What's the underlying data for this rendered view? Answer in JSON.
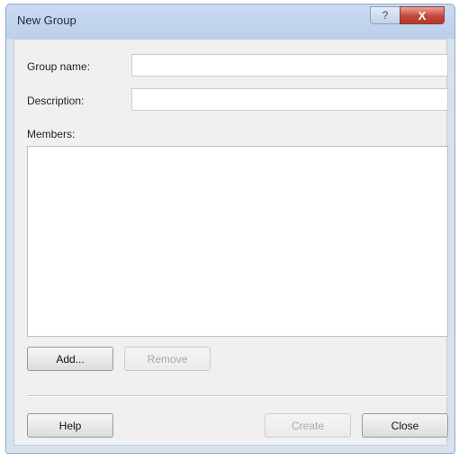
{
  "window": {
    "title": "New Group",
    "help_label": "?",
    "close_label": "X"
  },
  "form": {
    "group_name_label": "Group name:",
    "group_name_value": "",
    "description_label": "Description:",
    "description_value": "",
    "members_label": "Members:",
    "members": []
  },
  "buttons": {
    "add": "Add...",
    "remove": "Remove",
    "help": "Help",
    "create": "Create",
    "close": "Close"
  }
}
